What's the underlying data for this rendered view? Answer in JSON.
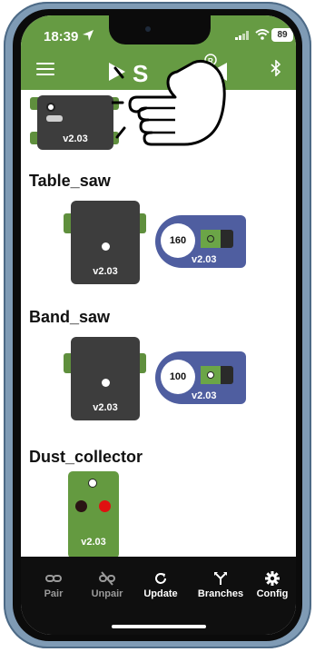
{
  "status": {
    "time": "18:39",
    "battery": "89"
  },
  "header": {
    "logo_text": "S",
    "registered_mark": "®"
  },
  "top_device": {
    "version": "v2.03"
  },
  "sections": [
    {
      "title": "Table_saw",
      "controller_version": "v2.03",
      "tool_value": "160",
      "tool_version": "v2.03"
    },
    {
      "title": "Band_saw",
      "controller_version": "v2.03",
      "tool_value": "100",
      "tool_version": "v2.03"
    },
    {
      "title": "Dust_collector",
      "module_version": "v2.03"
    }
  ],
  "bottom_nav": [
    {
      "label": "Pair",
      "icon": "link-icon"
    },
    {
      "label": "Unpair",
      "icon": "unlink-icon"
    },
    {
      "label": "Update",
      "icon": "refresh-icon"
    },
    {
      "label": "Branches",
      "icon": "branches-icon"
    },
    {
      "label": "Config",
      "icon": "gear-icon"
    }
  ],
  "colors": {
    "accent_green": "#669b43",
    "tool_blue": "#4f5ea0",
    "device_gray": "#3d3d3d",
    "nav_bg": "#0f0f0f"
  }
}
